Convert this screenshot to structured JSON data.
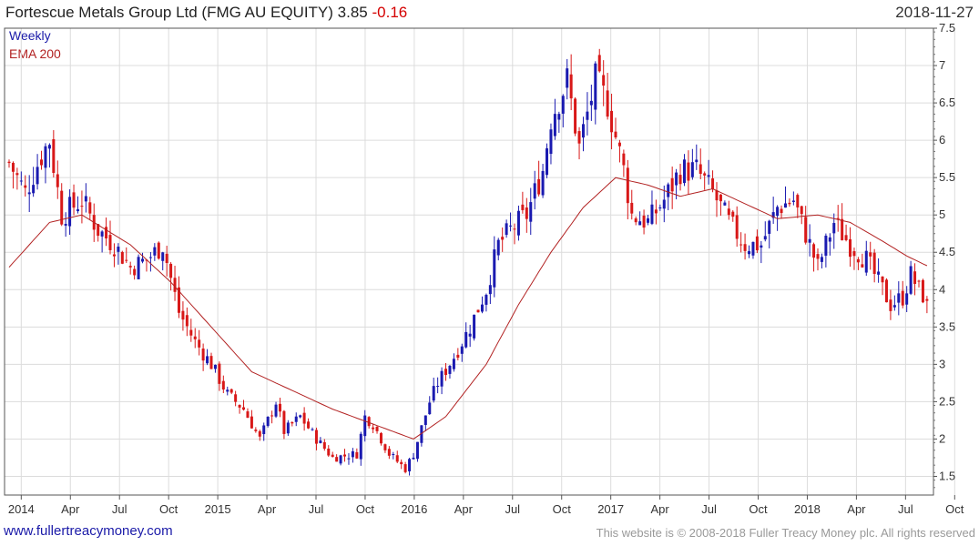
{
  "header": {
    "title": "Fortescue Metals Group Ltd (FMG AU EQUITY) 3.85",
    "change": "-0.16",
    "date": "2018-11-27"
  },
  "legend": {
    "weekly": "Weekly",
    "ema": "EMA 200"
  },
  "footer": {
    "site": "www.fullertreacymoney.com",
    "copyright": "This website is © 2008-2018 Fuller Treacy Money plc. All rights reserved"
  },
  "colors": {
    "up": "#1a1ab0",
    "down": "#d81818",
    "ema": "#b22222",
    "grid": "#dcdcdc"
  },
  "chart_data": {
    "type": "candlestick",
    "frequency": "weekly",
    "x_axis": {
      "tick_labels": [
        "2014",
        "Apr",
        "Jul",
        "Oct",
        "2015",
        "Apr",
        "Jul",
        "Oct",
        "2016",
        "Apr",
        "Jul",
        "Oct",
        "2017",
        "Apr",
        "Jul",
        "Oct",
        "2018",
        "Apr",
        "Jul",
        "Oct"
      ]
    },
    "y_axis": {
      "position": "right",
      "range": [
        1.25,
        7.5
      ],
      "ticks": [
        1.5,
        2,
        2.5,
        3,
        3.5,
        4,
        4.5,
        5,
        5.5,
        6,
        6.5,
        7,
        7.5
      ]
    },
    "grid": true,
    "series": [
      {
        "name": "Weekly",
        "style": "candles",
        "close_path": [
          [
            0,
            5.7
          ],
          [
            4,
            5.3
          ],
          [
            8,
            5.8
          ],
          [
            10,
            6.0
          ],
          [
            13,
            5.0
          ],
          [
            18,
            5.2
          ],
          [
            22,
            4.8
          ],
          [
            26,
            4.6
          ],
          [
            30,
            4.3
          ],
          [
            34,
            4.4
          ],
          [
            38,
            4.6
          ],
          [
            42,
            3.7
          ],
          [
            46,
            3.3
          ],
          [
            50,
            3.0
          ],
          [
            54,
            2.6
          ],
          [
            58,
            2.4
          ],
          [
            62,
            2.0
          ],
          [
            66,
            2.5
          ],
          [
            68,
            2.1
          ],
          [
            72,
            2.3
          ],
          [
            76,
            2.0
          ],
          [
            80,
            1.75
          ],
          [
            86,
            1.8
          ],
          [
            88,
            2.3
          ],
          [
            90,
            2.2
          ],
          [
            94,
            1.8
          ],
          [
            98,
            1.6
          ],
          [
            100,
            1.8
          ],
          [
            104,
            2.5
          ],
          [
            106,
            2.75
          ],
          [
            110,
            3.1
          ],
          [
            114,
            3.5
          ],
          [
            118,
            4.0
          ],
          [
            121,
            4.6
          ],
          [
            124,
            4.8
          ],
          [
            128,
            5.0
          ],
          [
            132,
            5.6
          ],
          [
            134,
            6.3
          ],
          [
            138,
            6.8
          ],
          [
            141,
            5.9
          ],
          [
            145,
            6.8
          ],
          [
            148,
            6.5
          ],
          [
            152,
            5.6
          ],
          [
            154,
            5.0
          ],
          [
            158,
            4.9
          ],
          [
            162,
            5.2
          ],
          [
            166,
            5.6
          ],
          [
            170,
            5.6
          ],
          [
            174,
            5.3
          ],
          [
            178,
            4.9
          ],
          [
            182,
            4.6
          ],
          [
            186,
            4.6
          ],
          [
            190,
            5.1
          ],
          [
            194,
            5.2
          ],
          [
            198,
            4.6
          ],
          [
            200,
            4.3
          ],
          [
            204,
            4.9
          ],
          [
            208,
            4.6
          ],
          [
            212,
            4.4
          ],
          [
            215,
            4.1
          ],
          [
            218,
            3.8
          ],
          [
            221,
            3.9
          ],
          [
            223,
            4.2
          ],
          [
            225,
            4.0
          ],
          [
            227,
            3.85
          ]
        ]
      },
      {
        "name": "EMA 200",
        "style": "line",
        "values": [
          [
            0,
            4.3
          ],
          [
            10,
            4.9
          ],
          [
            18,
            5.0
          ],
          [
            30,
            4.6
          ],
          [
            40,
            4.1
          ],
          [
            50,
            3.5
          ],
          [
            60,
            2.9
          ],
          [
            70,
            2.65
          ],
          [
            80,
            2.4
          ],
          [
            90,
            2.2
          ],
          [
            100,
            2.0
          ],
          [
            108,
            2.3
          ],
          [
            118,
            3.0
          ],
          [
            126,
            3.8
          ],
          [
            134,
            4.5
          ],
          [
            142,
            5.1
          ],
          [
            150,
            5.5
          ],
          [
            158,
            5.4
          ],
          [
            166,
            5.25
          ],
          [
            174,
            5.35
          ],
          [
            182,
            5.15
          ],
          [
            190,
            4.95
          ],
          [
            200,
            5.0
          ],
          [
            208,
            4.9
          ],
          [
            216,
            4.65
          ],
          [
            222,
            4.45
          ],
          [
            227,
            4.32
          ]
        ]
      }
    ]
  }
}
